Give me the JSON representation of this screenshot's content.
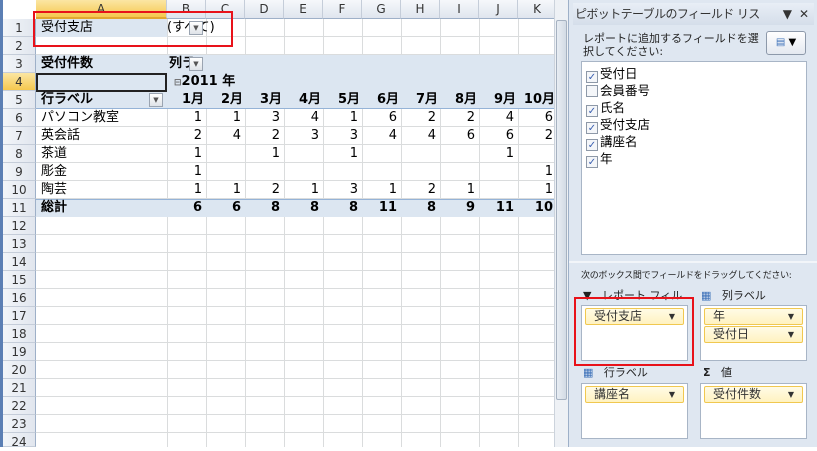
{
  "columns": [
    "A",
    "B",
    "C",
    "D",
    "E",
    "F",
    "G",
    "H",
    "I",
    "J",
    "K"
  ],
  "rows": [
    "1",
    "2",
    "3",
    "4",
    "5",
    "6",
    "7",
    "8",
    "9",
    "10",
    "11",
    "12",
    "13",
    "14",
    "15",
    "16",
    "17",
    "18",
    "19",
    "20",
    "21",
    "22",
    "23",
    "24"
  ],
  "filter": {
    "label": "受付支店",
    "value": "(すべて)"
  },
  "pivot": {
    "value_label": "受付件数",
    "col_label": "列ラ",
    "year": "2011 年",
    "row_label": "行ラベル",
    "months": [
      "1月",
      "2月",
      "3月",
      "4月",
      "5月",
      "6月",
      "7月",
      "8月",
      "9月",
      "10月"
    ],
    "rows": [
      {
        "name": "パソコン教室",
        "values": [
          "1",
          "1",
          "3",
          "4",
          "1",
          "6",
          "2",
          "2",
          "4",
          "6"
        ]
      },
      {
        "name": "英会話",
        "values": [
          "2",
          "4",
          "2",
          "3",
          "3",
          "4",
          "4",
          "6",
          "6",
          "2"
        ]
      },
      {
        "name": "茶道",
        "values": [
          "1",
          "",
          "1",
          "",
          "1",
          "",
          "",
          "",
          "1",
          ""
        ]
      },
      {
        "name": "彫金",
        "values": [
          "1",
          "",
          "",
          "",
          "",
          "",
          "",
          "",
          "",
          "1"
        ]
      },
      {
        "name": "陶芸",
        "values": [
          "1",
          "1",
          "2",
          "1",
          "3",
          "1",
          "2",
          "1",
          "",
          "1"
        ]
      }
    ],
    "total": {
      "name": "総計",
      "values": [
        "6",
        "6",
        "8",
        "8",
        "8",
        "11",
        "8",
        "9",
        "11",
        "10"
      ]
    }
  },
  "panel": {
    "title": "ピボットテーブルのフィールド リス",
    "choose_text": "レポートに追加するフィールドを選択してください:",
    "fields": [
      {
        "label": "受付日",
        "checked": true
      },
      {
        "label": "会員番号",
        "checked": false
      },
      {
        "label": "氏名",
        "checked": true
      },
      {
        "label": "受付支店",
        "checked": true
      },
      {
        "label": "講座名",
        "checked": true
      },
      {
        "label": "年",
        "checked": true
      }
    ],
    "drag_text": "次のボックス間でフィールドをドラッグしてください:",
    "report_filter": {
      "header": "レポート フィル...",
      "items": [
        "受付支店"
      ]
    },
    "column_labels": {
      "header": "列ラベル",
      "items": [
        "年",
        "受付日"
      ]
    },
    "row_labels": {
      "header": "行ラベル",
      "items": [
        "講座名"
      ]
    },
    "values": {
      "header": "値",
      "items": [
        "受付件数"
      ]
    }
  },
  "colors": {
    "highlight": "#e8121a",
    "pivot_band": "#dce6f1"
  }
}
